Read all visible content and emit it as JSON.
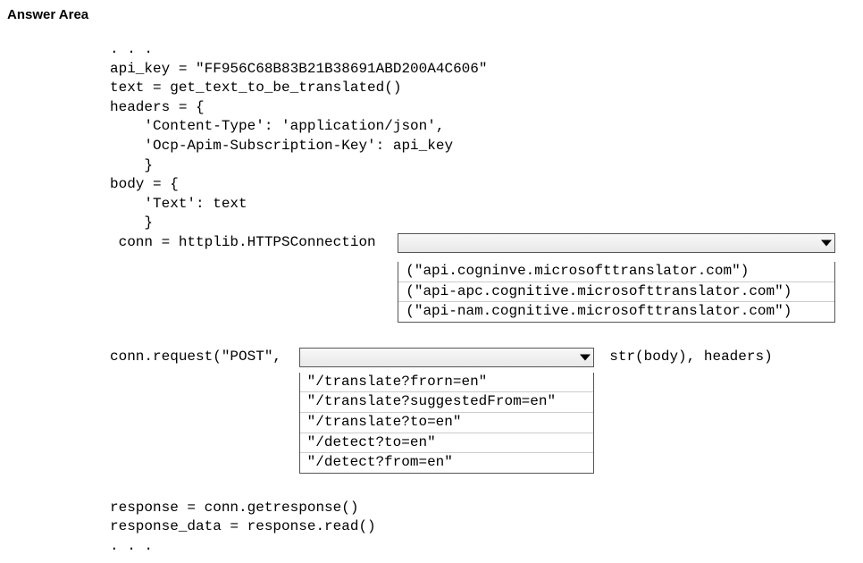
{
  "title": "Answer Area",
  "code": {
    "l1": ". . .",
    "l2": "api_key = \"FF956C68B83B21B38691ABD200A4C606\"",
    "l3": "text = get_text_to_be_translated()",
    "l4": "headers = {",
    "l5": "    'Content-Type': 'application/json',",
    "l6": "    'Ocp-Apim-Subscription-Key': api_key",
    "l7": "    }",
    "l8": "body = {",
    "l9": "    'Text': text",
    "l10": "    }",
    "l11": " conn = httplib.HTTPSConnection ",
    "l12a": "conn.request(\"POST\", ",
    "l12b": " str(body), headers)",
    "l13": "response = conn.getresponse()",
    "l14": "response_data = response.read()",
    "l15": ". . ."
  },
  "dropdown1": {
    "options": {
      "o1": "(\"api.cogninve.microsofttranslator.com\")",
      "o2": "(\"api-apc.cognitive.microsofttranslator.com\")",
      "o3": "(\"api-nam.cognitive.microsofttranslator.com\")"
    }
  },
  "dropdown2": {
    "options": {
      "o1": "\"/translate?frorn=en\"",
      "o2": "\"/translate?suggestedFrom=en\"",
      "o3": "\"/translate?to=en\"",
      "o4": "\"/detect?to=en\"",
      "o5": "\"/detect?from=en\""
    }
  }
}
